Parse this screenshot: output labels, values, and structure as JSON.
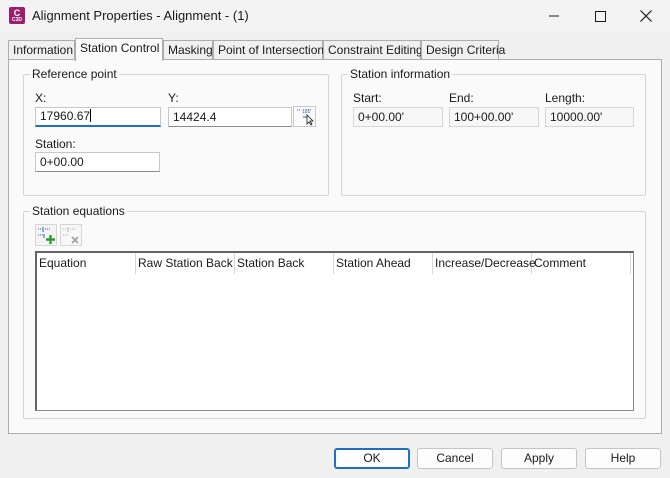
{
  "window": {
    "title": "Alignment Properties - Alignment - (1)",
    "app_icon": {
      "letter": "C",
      "sub": "C3D",
      "color": "#9c1f6e",
      "icon": "civil3d-app-icon"
    },
    "controls": {
      "minimize": "minimize-icon",
      "maximize": "maximize-icon",
      "close": "close-icon"
    }
  },
  "tabs": [
    {
      "label": "Information",
      "active": false
    },
    {
      "label": "Station Control",
      "active": true
    },
    {
      "label": "Masking",
      "active": false
    },
    {
      "label": "Point of Intersection",
      "active": false
    },
    {
      "label": "Constraint Editing",
      "active": false
    },
    {
      "label": "Design Criteria",
      "active": false
    }
  ],
  "reference_point": {
    "group_label": "Reference point",
    "x_label": "X:",
    "x_value": "17960.67",
    "y_label": "Y:",
    "y_value": "14424.4",
    "pick_button_icon": "pick-point-icon",
    "station_label": "Station:",
    "station_value": "0+00.00"
  },
  "station_information": {
    "group_label": "Station information",
    "start_label": "Start:",
    "start_value": "0+00.00'",
    "end_label": "End:",
    "end_value": "100+00.00'",
    "length_label": "Length:",
    "length_value": "10000.00'"
  },
  "station_equations": {
    "group_label": "Station equations",
    "add_button_icon": "add-station-equation-icon",
    "delete_button_icon": "delete-station-equation-icon",
    "columns": [
      "Equation",
      "Raw Station Back",
      "Station Back",
      "Station Ahead",
      "Increase/Decrease",
      "Comment"
    ],
    "rows": []
  },
  "buttons": {
    "ok": "OK",
    "cancel": "Cancel",
    "apply": "Apply",
    "help": "Help"
  },
  "colors": {
    "accent": "#1e6fc4",
    "app_icon": "#9c1f6e",
    "add_green": "#2e9b2e"
  }
}
